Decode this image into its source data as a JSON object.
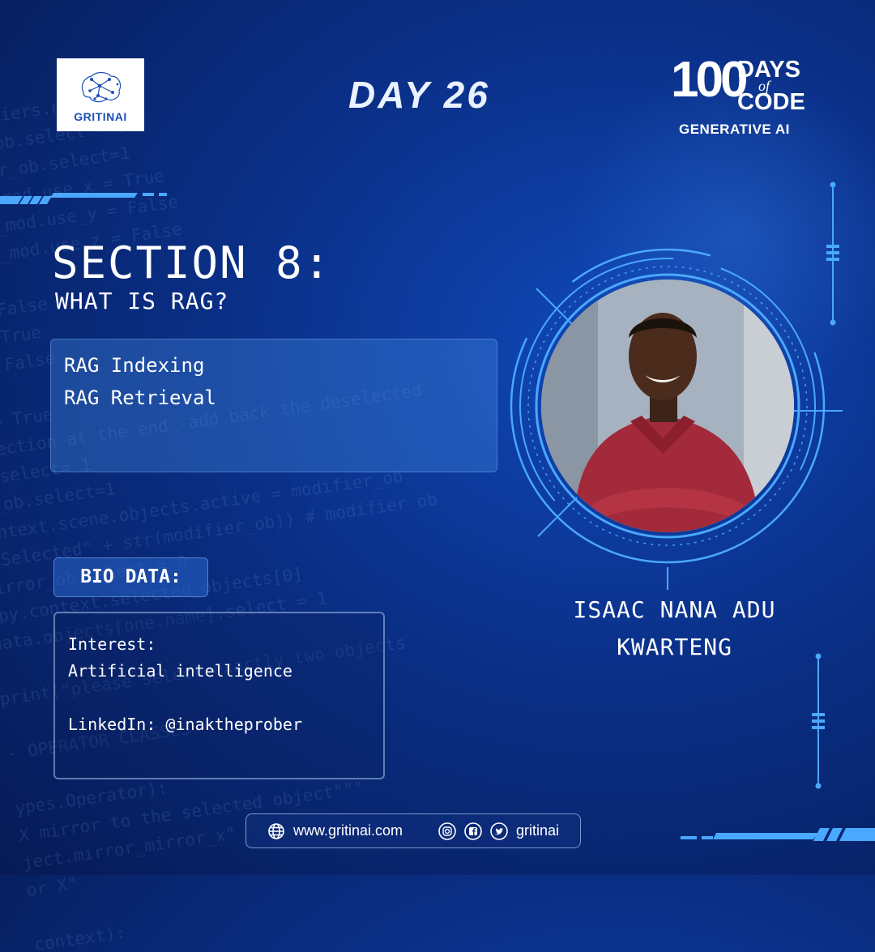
{
  "brand": {
    "logo_text": "GRITINAI"
  },
  "header": {
    "day_title": "DAY 26"
  },
  "badge": {
    "number": "100",
    "days": "DAYS",
    "of": "of",
    "code": "CODE",
    "subtitle": "GENERATIVE AI"
  },
  "section": {
    "title": "SECTION 8:",
    "subtitle": "WHAT IS RAG?",
    "topics": [
      "RAG Indexing",
      "RAG Retrieval"
    ]
  },
  "bio": {
    "label": "BIO DATA:",
    "lines": [
      "Interest:",
      "Artificial intelligence",
      "",
      "LinkedIn: @inaktheprober"
    ]
  },
  "person": {
    "name_line1": "ISAAC NANA ADU",
    "name_line2": "KWARTENG"
  },
  "footer": {
    "website": "www.gritinai.com",
    "handle": "gritinai"
  },
  "colors": {
    "background": "#0a2f86",
    "accent": "#4aa8ff",
    "panel": "#2f6fcf"
  },
  "icons": [
    "globe-icon",
    "instagram-icon",
    "facebook-icon",
    "twitter-icon"
  ]
}
